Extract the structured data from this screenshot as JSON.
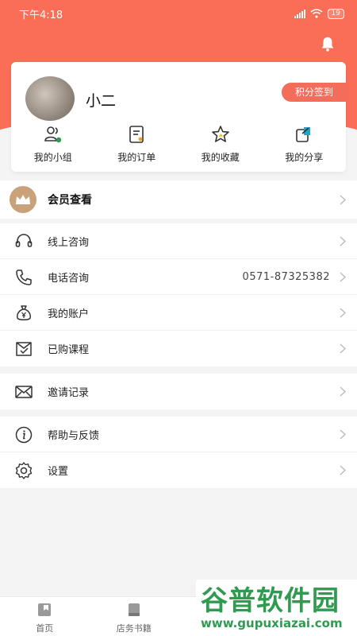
{
  "status_bar": {
    "time": "下午4:18",
    "battery": "19"
  },
  "profile": {
    "name": "小二",
    "signin_label": "积分签到"
  },
  "quick_actions": [
    {
      "label": "我的小组",
      "icon": "group-icon"
    },
    {
      "label": "我的订单",
      "icon": "order-icon"
    },
    {
      "label": "我的收藏",
      "icon": "star-icon"
    },
    {
      "label": "我的分享",
      "icon": "share-icon"
    }
  ],
  "vip": {
    "label": "会员查看",
    "icon": "crown-icon"
  },
  "menu_group_1": [
    {
      "label": "线上咨询",
      "icon": "headset-icon"
    },
    {
      "label": "电话咨询",
      "value": "0571-87325382",
      "icon": "phone-icon"
    },
    {
      "label": "我的账户",
      "icon": "money-bag-icon"
    },
    {
      "label": "已购课程",
      "icon": "course-icon"
    }
  ],
  "menu_group_2": [
    {
      "label": "邀请记录",
      "icon": "mail-icon"
    }
  ],
  "menu_group_3": [
    {
      "label": "帮助与反馈",
      "icon": "info-icon"
    },
    {
      "label": "设置",
      "icon": "settings-icon"
    }
  ],
  "tabbar": [
    {
      "label": "首页",
      "icon": "home-icon"
    },
    {
      "label": "店务书籍",
      "icon": "book-icon"
    }
  ],
  "watermark": {
    "title": "谷普软件园",
    "url": "www.gupuxiazai.com"
  },
  "colors": {
    "brand": "#fa6e58",
    "signin": "#f36d5a",
    "vip_gold": "#c9a27a",
    "watermark_green": "#2e9b50"
  }
}
